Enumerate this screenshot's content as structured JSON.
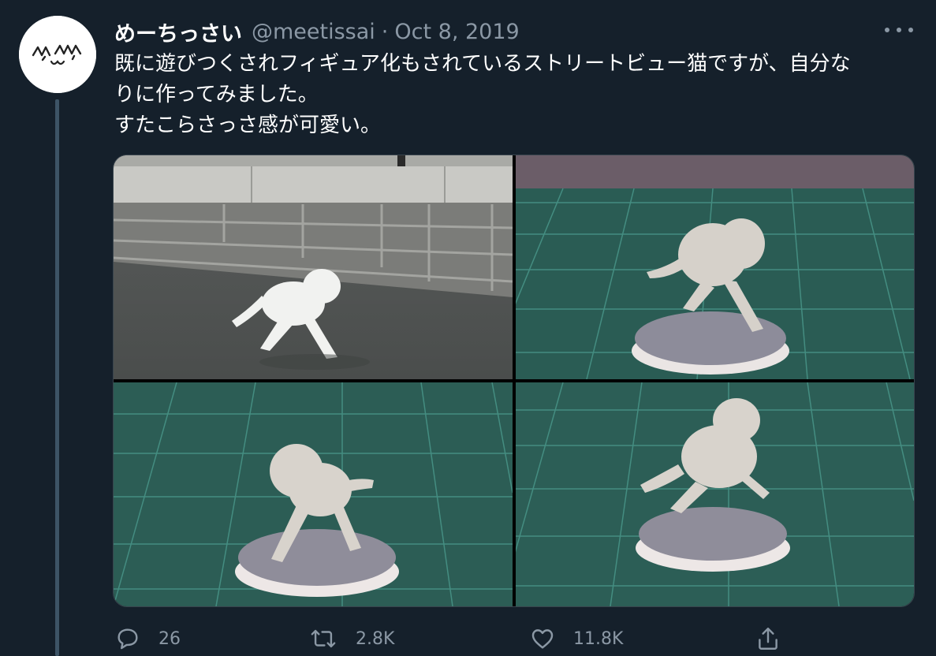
{
  "tweet": {
    "display_name": "めーちっさい",
    "handle": "@meetissai",
    "separator": "·",
    "date": "Oct 8, 2019",
    "text_lines": [
      "既に遊びつくされフィギュア化もされているストリートビュー猫ですが、自分な",
      "りに作ってみました。",
      "すたこらさっさ感が可愛い。"
    ]
  },
  "actions": {
    "reply_count": "26",
    "retweet_count": "2.8K",
    "like_count": "11.8K"
  },
  "media": [
    {
      "icon": "photo",
      "subject": "street-view-cat"
    },
    {
      "icon": "photo",
      "subject": "cat-figure-side"
    },
    {
      "icon": "photo",
      "subject": "cat-figure-front"
    },
    {
      "icon": "photo",
      "subject": "cat-figure-back"
    }
  ],
  "colors": {
    "background": "#15202b",
    "text_primary": "#ffffff",
    "text_secondary": "#8b98a5",
    "thread_line": "#3d5466",
    "border": "#38444d"
  },
  "icons": {
    "reply": "reply-icon",
    "retweet": "retweet-icon",
    "like": "heart-icon",
    "share": "share-icon",
    "more": "more-icon"
  }
}
